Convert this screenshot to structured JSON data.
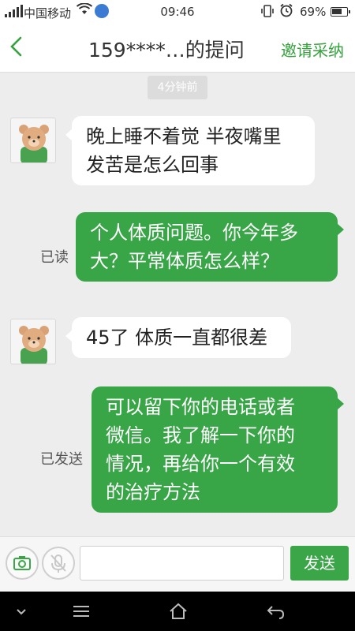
{
  "status_bar": {
    "carrier": "中国移动",
    "time": "09:46",
    "battery": "69%",
    "battery_level": 0.69
  },
  "header": {
    "title": "159****…的提问",
    "invite_label": "邀请采纳"
  },
  "chat": {
    "timestamp": "4分钟前",
    "messages": [
      {
        "side": "left",
        "text": "晚上睡不着觉 半夜嘴里\n发苦是怎么回事"
      },
      {
        "side": "right",
        "status": "已读",
        "text": "个人体质问题。你今年多\n大？平常体质怎么样？"
      },
      {
        "side": "left",
        "text": "45了 体质一直都很差"
      },
      {
        "side": "right",
        "status": "已发送",
        "text": "可以留下你的电话或者\n微信。我了解一下你的\n情况，再给你一个有效\n的治疗方法"
      }
    ]
  },
  "input_bar": {
    "placeholder": "",
    "send_label": "发送"
  },
  "icons": {
    "camera": "camera-icon",
    "mic": "mic-off-icon",
    "back": "chevron-left-icon"
  },
  "colors": {
    "accent": "#38a547",
    "background": "#ededed"
  }
}
